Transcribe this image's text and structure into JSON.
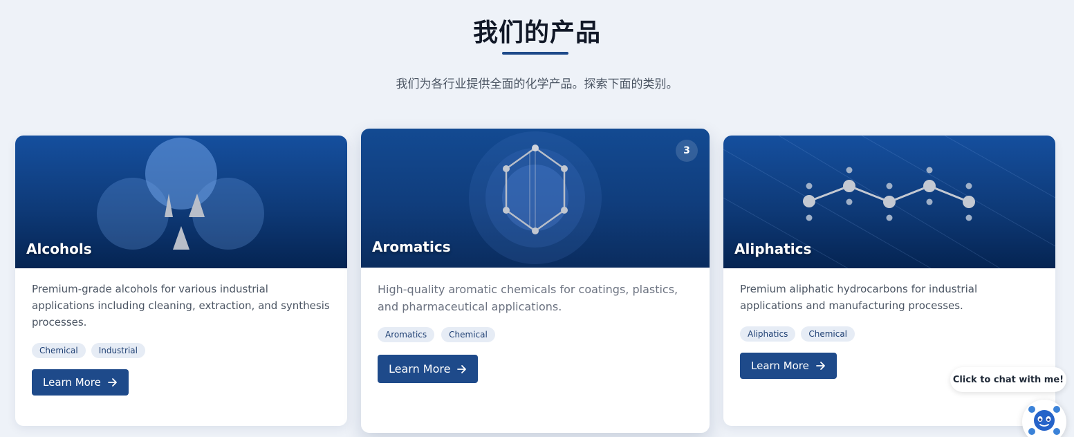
{
  "section": {
    "title": "我们的产品",
    "subtitle": "我们为各行业提供全面的化学产品。探索下面的类别。"
  },
  "cards": [
    {
      "name": "Alcohols",
      "description": "Premium-grade alcohols for various industrial applications including cleaning, extraction, and synthesis processes.",
      "tags": [
        "Chemical",
        "Industrial"
      ],
      "button": "Learn More",
      "illustration": "molecule-circles-icon"
    },
    {
      "name": "Aromatics",
      "badge": "3",
      "description": "High-quality aromatic chemicals for coatings, plastics, and pharmaceutical applications.",
      "tags": [
        "Aromatics",
        "Chemical"
      ],
      "button": "Learn More",
      "illustration": "benzene-ring-icon"
    },
    {
      "name": "Aliphatics",
      "description": "Premium aliphatic hydrocarbons for industrial applications and manufacturing processes.",
      "tags": [
        "Aliphatics",
        "Chemical"
      ],
      "button": "Learn More",
      "illustration": "carbon-chain-icon"
    }
  ],
  "chat": {
    "prompt": "Click to chat with me!",
    "avatar": "robot-icon"
  },
  "colors": {
    "accent": "#1e4a8a",
    "page_background": "#eef2f8",
    "card_header": "#0e3a78"
  }
}
